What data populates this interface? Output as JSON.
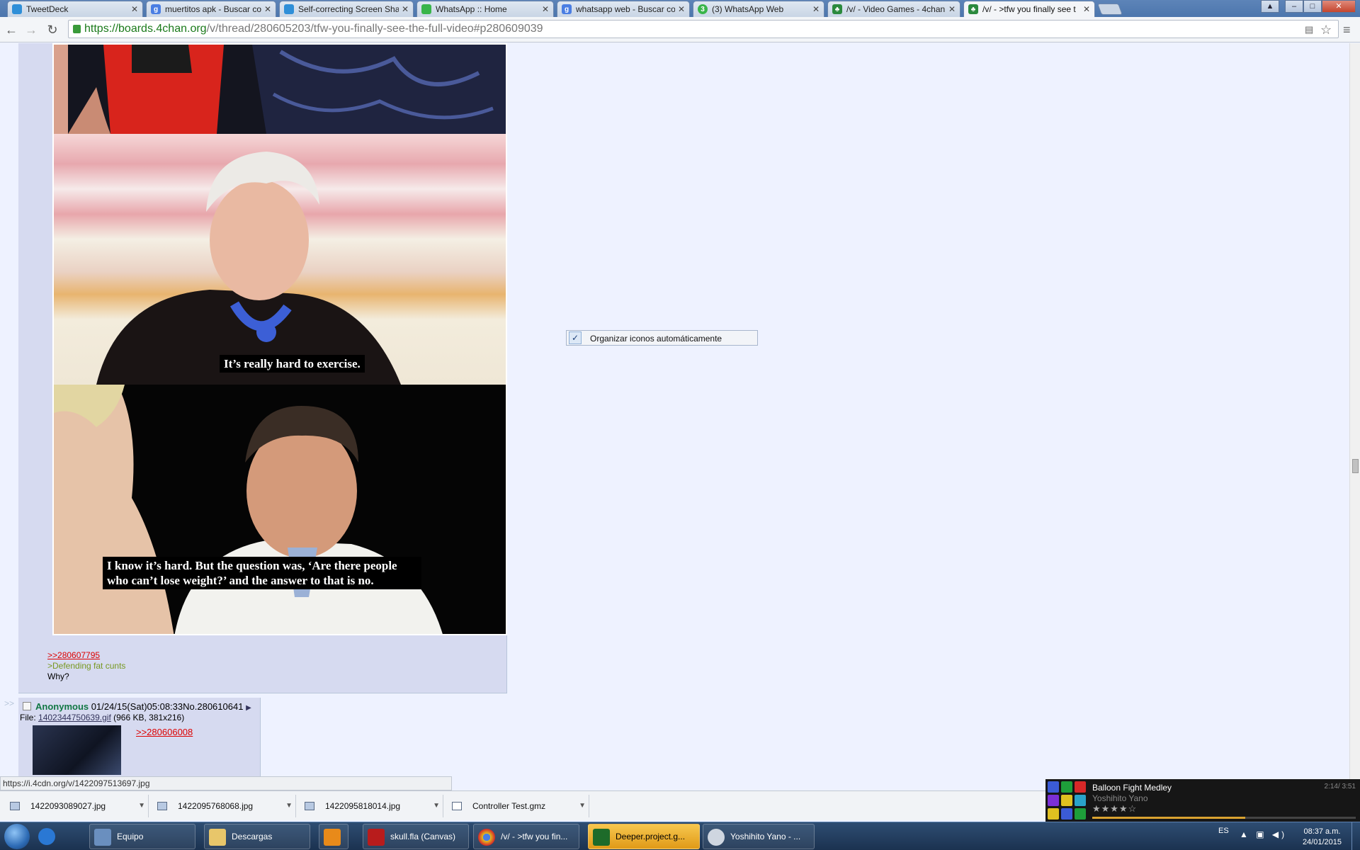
{
  "tabs": [
    {
      "label": "TweetDeck",
      "favicon_color": "#2f8fd8"
    },
    {
      "label": "muertitos apk - Buscar co",
      "favicon_color": "#4a7ee3"
    },
    {
      "label": "Self-correcting Screen Sha",
      "favicon_color": "#2f8fd8"
    },
    {
      "label": "WhatsApp :: Home",
      "favicon_color": "#39b54a"
    },
    {
      "label": "whatsapp web - Buscar co",
      "favicon_color": "#4a7ee3"
    },
    {
      "label": "(3) WhatsApp Web",
      "favicon_color": "#39b54a"
    },
    {
      "label": "/v/ - Video Games - 4chan",
      "favicon_color": "#2b8a3e"
    },
    {
      "label": "/v/ - >tfw you finally see t",
      "favicon_color": "#2b8a3e",
      "active": true
    }
  ],
  "toolbar": {
    "url_scheme": "https://",
    "url_host": "boards.4chan.org",
    "url_path": "/v/thread/280605203/tfw-you-finally-see-the-full-video#p280609039"
  },
  "post1": {
    "captions": {
      "panel2": "It’s really hard to exercise.",
      "panel3_line1": "I know it’s hard. But the question was, ‘Are there people",
      "panel3_line2": "who can’t lose weight?’ and the answer to that is no."
    },
    "quotelink": ">>280607795",
    "greentext": ">Defending fat cunts",
    "comment": "Why?"
  },
  "post2": {
    "side_arrows": ">>",
    "name": "Anonymous",
    "datetime": "01/24/15(Sat)05:08:33",
    "number": "No.280610641",
    "arrow": "▶",
    "file_prefix": "File: ",
    "file_name": "1402344750639.gif",
    "file_info": " (966 KB, 381x216)",
    "quotelink": ">>280606008"
  },
  "context_menu": {
    "item_label": "Organizar iconos automáticamente",
    "checked": true
  },
  "status_bar": {
    "url": "https://i.4cdn.org/v/1422097513697.jpg"
  },
  "downloads": [
    {
      "filename": "1422093089027.jpg"
    },
    {
      "filename": "1422095768068.jpg"
    },
    {
      "filename": "1422095818014.jpg"
    },
    {
      "filename": "Controller Test.gmz"
    }
  ],
  "media_player": {
    "title": "Balloon Fight Medley",
    "artist": "Yoshihito Yano",
    "time": "2:14/ 3:51",
    "progress": 0.58,
    "stars": "★★★★☆"
  },
  "taskbar": {
    "apps": [
      {
        "label": "Equipo"
      },
      {
        "label": "Descargas"
      },
      {
        "label": ""
      },
      {
        "label": "skull.fla (Canvas)"
      },
      {
        "label": "/v/ - >tfw you fin..."
      },
      {
        "label": "Deeper.project.g...",
        "highlight": true
      },
      {
        "label": "Yoshihito Yano - ..."
      }
    ],
    "language": "ES",
    "time": "08:37 a.m.",
    "date": "24/01/2015"
  }
}
